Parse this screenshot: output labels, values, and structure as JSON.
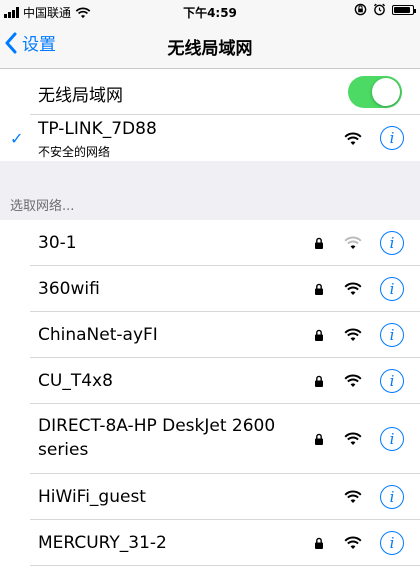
{
  "status_bar": {
    "carrier": "中国联通",
    "time": "下午4:59",
    "battery_level": 0.9
  },
  "nav": {
    "back_label": "设置",
    "title": "无线局域网",
    "tint_color": "#007aff"
  },
  "wlan_toggle": {
    "label": "无线局域网",
    "on": true,
    "color": "#4cd964"
  },
  "connected": {
    "name": "TP-LINK_7D88",
    "subtitle": "不安全的网络",
    "locked": false
  },
  "section_title": "选取网络...",
  "networks": [
    {
      "name": "30-1",
      "locked": true,
      "signal": "weak"
    },
    {
      "name": "360wifi",
      "locked": true,
      "signal": "full"
    },
    {
      "name": "ChinaNet-ayFI",
      "locked": true,
      "signal": "full"
    },
    {
      "name": "CU_T4x8",
      "locked": true,
      "signal": "full"
    },
    {
      "name": "DIRECT-8A-HP DeskJet 2600 series",
      "locked": true,
      "signal": "full"
    },
    {
      "name": "HiWiFi_guest",
      "locked": false,
      "signal": "full"
    },
    {
      "name": "MERCURY_31-2",
      "locked": true,
      "signal": "full"
    }
  ],
  "icons": {
    "signal": "cellular-signal-icon",
    "wifi": "wifi-icon",
    "lock": "lock-icon",
    "info": "info-icon",
    "checkmark": "checkmark-icon",
    "back": "chevron-left-icon",
    "rotation_lock": "rotation-lock-icon",
    "alarm": "alarm-icon",
    "battery": "battery-icon"
  }
}
